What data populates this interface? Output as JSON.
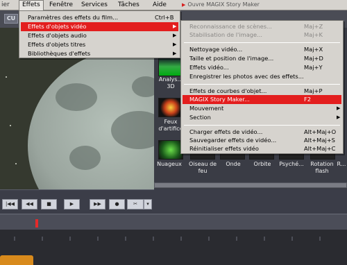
{
  "menubar": {
    "items": [
      "Effets",
      "Fenêtre",
      "Services",
      "Tâches",
      "Aide"
    ],
    "cut_label": "ier"
  },
  "status_hint": "Ouvre MAGIX Story Maker",
  "app": {
    "tab_label": "CU",
    "effects_panel": {
      "row1": [
        {
          "label": "Analys... 3D"
        }
      ],
      "row2": [
        {
          "label": "Feux d'artifice"
        }
      ],
      "row3": [
        {
          "label": "Nuageux"
        },
        {
          "label": "Oiseau de feu"
        },
        {
          "label": "Onde"
        },
        {
          "label": "Orbite"
        },
        {
          "label": "Psyché..."
        },
        {
          "label": "Rotation flash"
        },
        {
          "label": "R..."
        }
      ]
    },
    "transport_icons": [
      "skip-start-icon",
      "rewind-icon",
      "stop-icon",
      "play-icon",
      "fast-forward-icon",
      "record-icon",
      "scissors-icon"
    ]
  },
  "effets_menu": {
    "items": [
      {
        "label": "Paramètres des effets du film...",
        "shortcut": "Ctrl+B",
        "submenu": false,
        "highlighted": false
      },
      {
        "label": "Effets d'objets vidéo",
        "shortcut": "",
        "submenu": true,
        "highlighted": true
      },
      {
        "label": "Effets d'objets audio",
        "shortcut": "",
        "submenu": true,
        "highlighted": false
      },
      {
        "label": "Effets d'objets titres",
        "shortcut": "",
        "submenu": true,
        "highlighted": false
      },
      {
        "label": "Bibliothèques d'effets",
        "shortcut": "",
        "submenu": true,
        "highlighted": false
      }
    ]
  },
  "video_submenu": {
    "items": [
      {
        "label": "Reconnaissance de scènes...",
        "shortcut": "Maj+Z",
        "disabled": true
      },
      {
        "label": "Stabilisation de l'image...",
        "shortcut": "Maj+K",
        "disabled": true
      },
      {
        "label": "Nettoyage vidéo...",
        "shortcut": "Maj+X"
      },
      {
        "label": "Taille et position de l'image...",
        "shortcut": "Maj+D"
      },
      {
        "label": "Effets vidéo...",
        "shortcut": "Maj+Y"
      },
      {
        "label": "Enregistrer les photos avec des effets...",
        "shortcut": ""
      },
      {
        "label": "Effets de courbes d'objet...",
        "shortcut": "Maj+P"
      },
      {
        "label": "MAGIX Story Maker...",
        "shortcut": "F2",
        "highlighted": true
      },
      {
        "label": "Mouvement",
        "shortcut": "",
        "submenu": true
      },
      {
        "label": "Section",
        "shortcut": "",
        "submenu": true
      },
      {
        "label": "Charger effets de vidéo...",
        "shortcut": "Alt+Maj+O"
      },
      {
        "label": "Sauvegarder effets de vidéo...",
        "shortcut": "Alt+Maj+S"
      },
      {
        "label": "Réinitialiser effets vidéo",
        "shortcut": "Alt+Maj+C"
      }
    ]
  },
  "colors": {
    "highlight": "#e31e1e",
    "menu_bg": "#d6d3ce",
    "app_bg": "#3a3c45"
  }
}
